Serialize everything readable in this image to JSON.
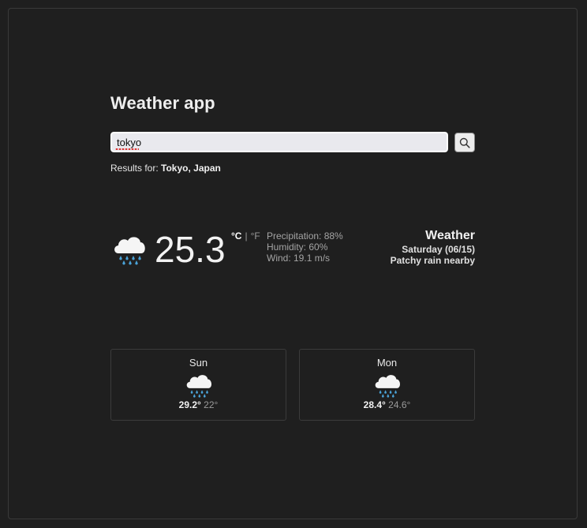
{
  "app": {
    "title": "Weather app"
  },
  "search": {
    "value": "tokyo",
    "icon": "search-icon"
  },
  "results": {
    "prefix": "Results for:",
    "location": "Tokyo, Japan"
  },
  "current": {
    "icon": "rain-cloud-icon",
    "temperature": "25.3",
    "unit_celsius": "°C",
    "unit_separator": "|",
    "unit_fahrenheit": "°F",
    "precipitation": "Precipitation: 88%",
    "humidity": "Humidity: 60%",
    "wind": "Wind: 19.1 m/s",
    "heading": "Weather",
    "date": "Saturday (06/15)",
    "condition": "Patchy rain nearby"
  },
  "forecast": [
    {
      "day": "Sun",
      "icon": "rain-cloud-icon",
      "high": "29.2°",
      "low": "22°"
    },
    {
      "day": "Mon",
      "icon": "rain-cloud-icon",
      "high": "28.4°",
      "low": "24.6°"
    }
  ],
  "colors": {
    "background": "#1f1f1f",
    "raindrop": "#4aa3d8",
    "cloud": "#f5f5f5"
  }
}
